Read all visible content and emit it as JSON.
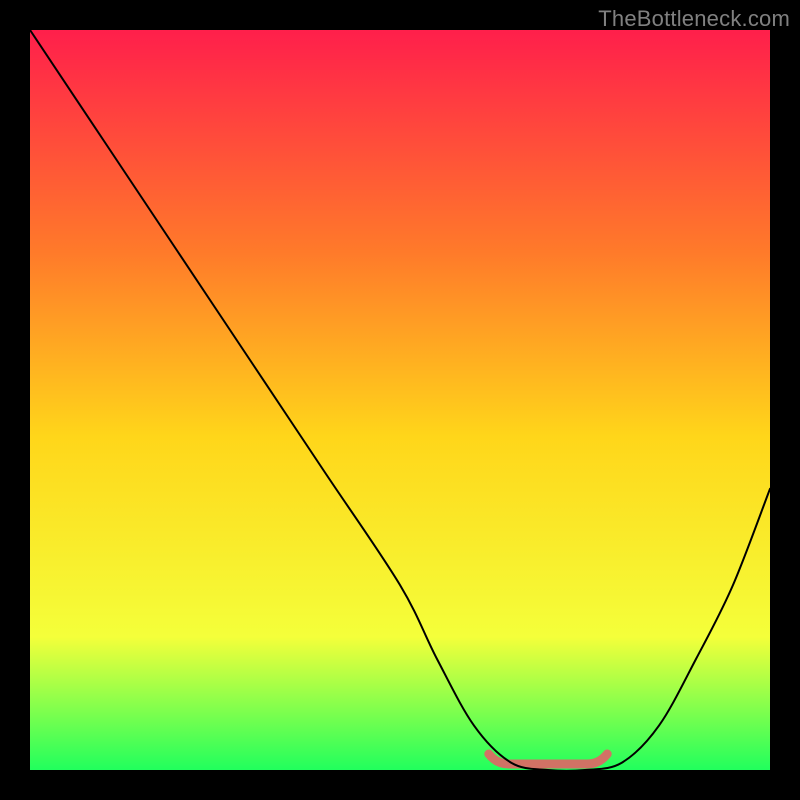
{
  "watermark": "TheBottleneck.com",
  "colors": {
    "background_black": "#000000",
    "gradient_top": "#ff1f4b",
    "gradient_mid_upper": "#ff7a2a",
    "gradient_mid": "#ffd61a",
    "gradient_lower": "#f4ff3a",
    "gradient_bottom": "#21ff5d",
    "curve_stroke": "#000000",
    "valley_highlight": "#e06666"
  },
  "chart_data": {
    "type": "line",
    "title": "",
    "xlabel": "",
    "ylabel": "",
    "xlim": [
      0,
      100
    ],
    "ylim": [
      0,
      100
    ],
    "grid": false,
    "legend": false,
    "series": [
      {
        "name": "bottleneck-curve",
        "x": [
          0,
          10,
          20,
          30,
          40,
          50,
          55,
          60,
          65,
          70,
          75,
          80,
          85,
          90,
          95,
          100
        ],
        "values": [
          100,
          85,
          70,
          55,
          40,
          25,
          15,
          6,
          1,
          0,
          0,
          1,
          6,
          15,
          25,
          38
        ]
      }
    ],
    "annotations": [
      {
        "name": "optimal-range",
        "x_start": 62,
        "x_end": 78,
        "y": 0
      }
    ]
  }
}
